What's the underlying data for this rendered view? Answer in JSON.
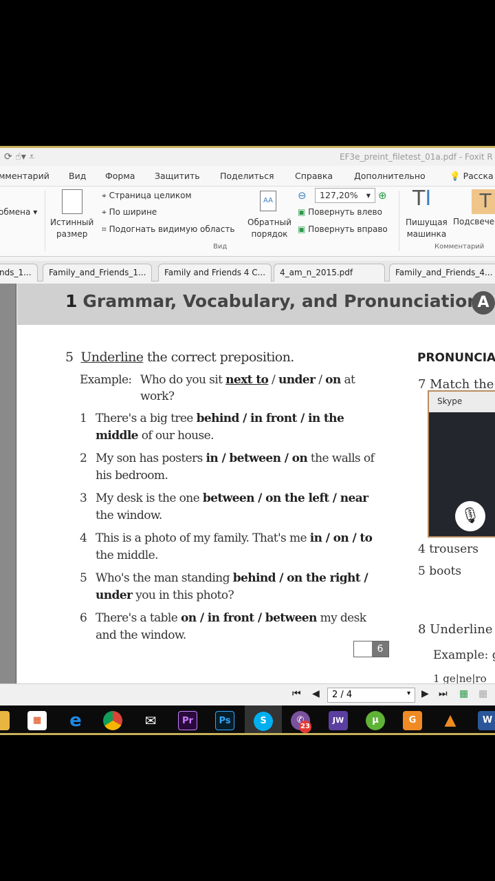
{
  "window": {
    "title": "EF3e_preint_filetest_01a.pdf - Foxit R"
  },
  "menu": [
    "мментарий",
    "Вид",
    "Форма",
    "Защитить",
    "Поделиться",
    "Справка",
    "Дополнительно",
    "Расска"
  ],
  "ribbon": {
    "clipboard": "обмена ▾",
    "true_size": [
      "Истинный",
      "размер"
    ],
    "fit_page": "Страница целиком",
    "fit_width": "По ширине",
    "fit_visible": "Подогнать видимую область",
    "reverse": [
      "Обратный",
      "порядок"
    ],
    "zoom": "127,20%",
    "rotate_left": "Повернуть влево",
    "rotate_right": "Повернуть вправо",
    "view_group": "Вид",
    "typewriter": [
      "Пишущая",
      "машинка"
    ],
    "highlight": "Подсвече",
    "comment_group": "Комментарий"
  },
  "tabs": [
    "nds_1...",
    "Family_and_Friends_1...",
    "Family and Friends 4 C...",
    "4_am_n_2015.pdf",
    "Family_and_Friends_4..."
  ],
  "page": {
    "unit_number": "1",
    "unit_title": "Grammar, Vocabulary, and Pronunciation",
    "badge": "A",
    "ex5": {
      "number": "5",
      "instruction_u": "Underline",
      "instruction_rest": " the correct preposition.",
      "example_label": "Example:",
      "example": [
        {
          "t": "Who do you sit "
        },
        {
          "t": "next to",
          "b": true,
          "u": true
        },
        {
          "t": " / "
        },
        {
          "t": "under",
          "b": true
        },
        {
          "t": " / "
        },
        {
          "t": "on",
          "b": true
        },
        {
          "t": " at work?"
        }
      ],
      "items": [
        [
          {
            "t": "There's a big tree "
          },
          {
            "t": "behind / in front / in the middle",
            "b": true
          },
          {
            "t": " of our house."
          }
        ],
        [
          {
            "t": "My son has posters "
          },
          {
            "t": "in / between / on",
            "b": true
          },
          {
            "t": " the walls of his bedroom."
          }
        ],
        [
          {
            "t": "My desk is the one "
          },
          {
            "t": "between / on the left / near",
            "b": true
          },
          {
            "t": " the window."
          }
        ],
        [
          {
            "t": "This is a photo of my family. That's me "
          },
          {
            "t": "in / on / to",
            "b": true
          },
          {
            "t": " the middle."
          }
        ],
        [
          {
            "t": "Who's the man standing "
          },
          {
            "t": "behind / on the right / under",
            "b": true
          },
          {
            "t": " you in this photo?"
          }
        ],
        [
          {
            "t": "There's a table "
          },
          {
            "t": "on / in front / between",
            "b": true
          },
          {
            "t": " my desk and the window."
          }
        ]
      ],
      "score": "6"
    },
    "pronunciation": "PRONUNCIA",
    "ex7": "7  Match the",
    "ex7_items": [
      "4  trousers",
      "5  boots"
    ],
    "ex8": "8  Underline",
    "ex8_example": "Example: g",
    "ex8_item": "1  ge|ne|ro"
  },
  "skype": {
    "title": "Skype"
  },
  "status": {
    "page": "2 / 4"
  },
  "taskbar": {
    "viber_badge": "23"
  }
}
